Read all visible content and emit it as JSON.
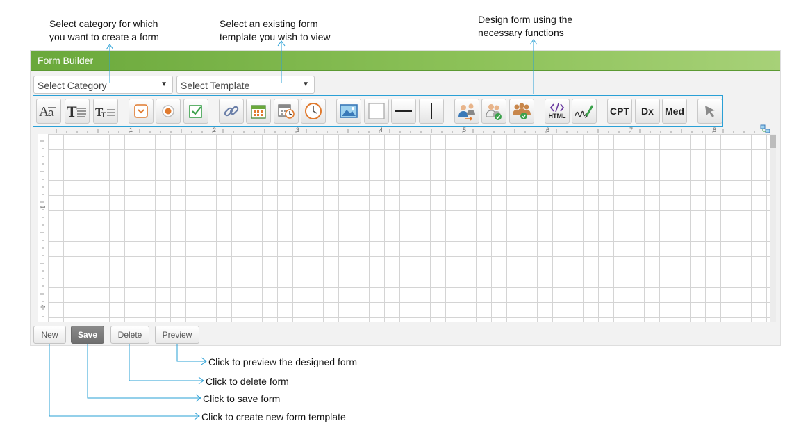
{
  "annotations": {
    "category_line1": "Select category for which",
    "category_line2": "you want to create a form",
    "template_line1": "Select an existing form",
    "template_line2": "template you wish to view",
    "design_line1": "Design form using the",
    "design_line2": "necessary functions",
    "preview": "Click to preview the designed form",
    "delete": "Click to delete form",
    "save": "Click to save form",
    "new": "Click to create new form template"
  },
  "panel": {
    "title": "Form Builder",
    "category_select": "Select Category",
    "template_select": "Select Template"
  },
  "toolbar": {
    "html_label": "HTML",
    "cpt_label": "CPT",
    "dx_label": "Dx",
    "med_label": "Med"
  },
  "ruler": {
    "h_numbers": [
      "1",
      "2",
      "3",
      "4",
      "5",
      "6",
      "7",
      "8"
    ],
    "v_numbers": [
      "1",
      "4"
    ]
  },
  "buttons": {
    "new": "New",
    "save": "Save",
    "delete": "Delete",
    "preview": "Preview"
  },
  "colors": {
    "header_green": "#6aa83b",
    "toolbar_border": "#2aa0d6",
    "arrow_blue": "#2aa0d6"
  }
}
